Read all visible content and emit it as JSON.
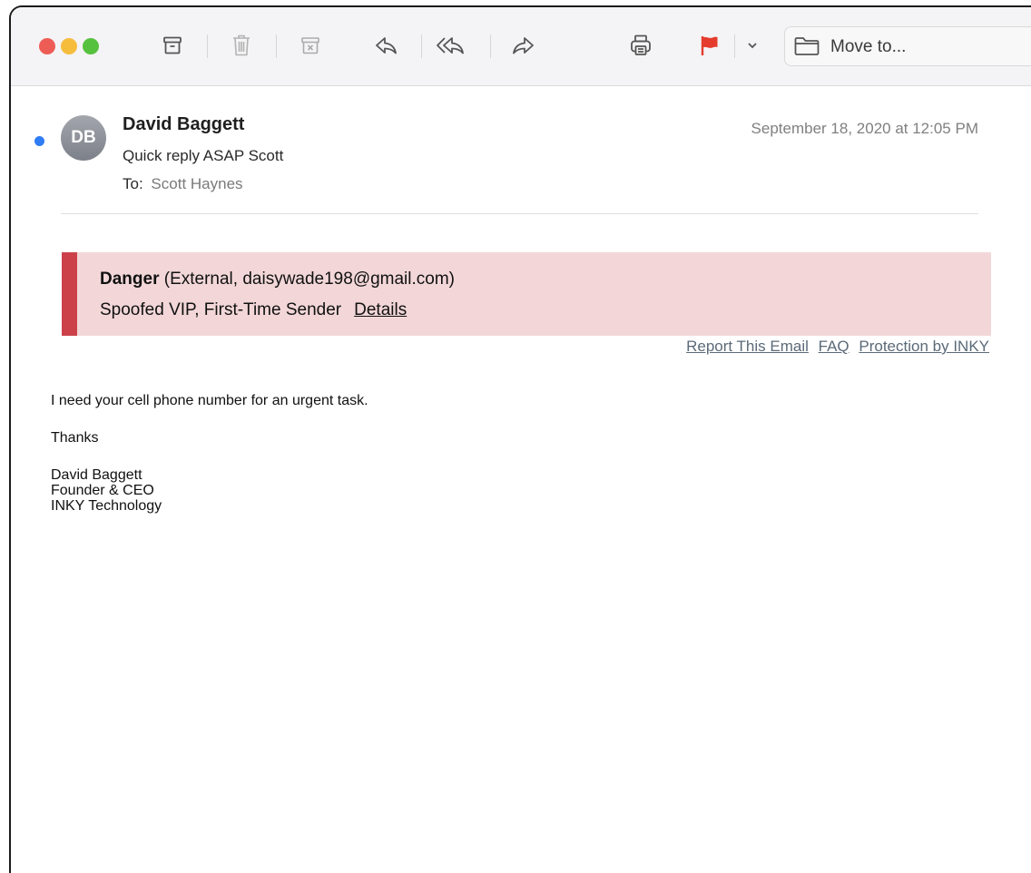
{
  "toolbar": {
    "buttons": [
      {
        "name": "archive",
        "icon": "archive-icon"
      },
      {
        "name": "delete",
        "icon": "trash-icon"
      },
      {
        "name": "junk",
        "icon": "junk-icon"
      },
      {
        "name": "reply",
        "icon": "reply-icon"
      },
      {
        "name": "reply-all",
        "icon": "reply-all-icon"
      },
      {
        "name": "forward",
        "icon": "forward-icon"
      },
      {
        "name": "print",
        "icon": "printer-icon"
      },
      {
        "name": "flag",
        "icon": "flag-icon",
        "color": "#e53b2c"
      },
      {
        "name": "flag-menu",
        "icon": "chevron-down-icon"
      }
    ],
    "move_to_label": "Move to..."
  },
  "message": {
    "sender_initials": "DB",
    "sender_name": "David Baggett",
    "subject": "Quick reply ASAP Scott",
    "to_label": "To:",
    "to_name": "Scott Haynes",
    "date": "September 18, 2020 at 12:05 PM",
    "unread_color": "#2f7cf6"
  },
  "banner": {
    "level": "Danger",
    "source": "(External, daisywade198@gmail.com)",
    "reasons": "Spoofed VIP, First-Time Sender",
    "details_link": "Details",
    "bar_color": "#cc4149",
    "background_color": "#f3d7d8"
  },
  "inky_links": {
    "report": "Report This Email",
    "faq": "FAQ",
    "protection": "Protection by INKY"
  },
  "body": {
    "line1": "I need your cell phone number for an urgent task.",
    "line2": "Thanks",
    "sig_name": "David Baggett",
    "sig_title": "Founder & CEO",
    "sig_company": "INKY Technology"
  }
}
